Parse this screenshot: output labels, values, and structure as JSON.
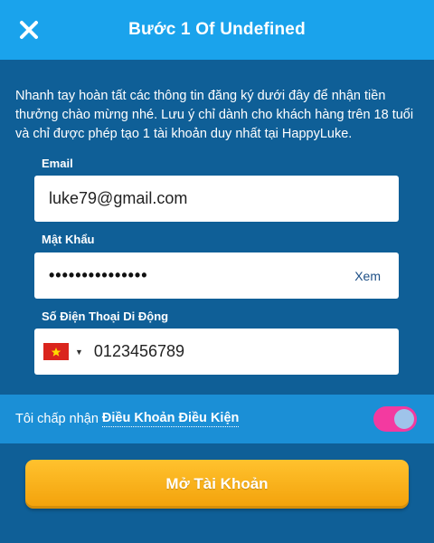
{
  "header": {
    "title": "Bước 1 Of Undefined",
    "close_icon": "close-icon"
  },
  "intro": {
    "text": "Nhanh tay hoàn tất các thông tin đăng ký dưới đây để nhận tiền thưởng chào mừng nhé. Lưu ý chỉ dành cho khách hàng trên 18 tuổi và chỉ được phép tạo 1 tài khoản duy nhất tại HappyLuke."
  },
  "form": {
    "email": {
      "label": "Email",
      "value": "luke79@gmail.com"
    },
    "password": {
      "label": "Mật Khẩu",
      "value": "•••••••••••••••",
      "show_label": "Xem"
    },
    "phone": {
      "label": "Số Điện Thoại Di Động",
      "value": "0123456789",
      "country_flag": "vietnam-flag-icon"
    }
  },
  "terms": {
    "text": "Tôi chấp nhận",
    "link": "Điều Khoản Điều Kiện",
    "toggle_on": true
  },
  "cta": {
    "label": "Mở Tài Khoản"
  },
  "colors": {
    "header": "#1aa3ec",
    "background": "#0f5f97",
    "terms_bar": "#1b8fd6",
    "toggle": "#f33aa0",
    "cta": "#f7ad14"
  }
}
